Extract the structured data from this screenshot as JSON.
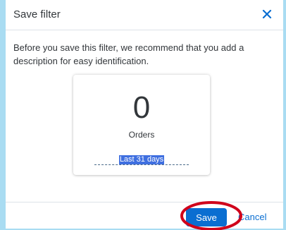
{
  "dialog": {
    "title": "Save filter",
    "close_icon": "close-icon",
    "message": "Before you save this filter, we recommend that you add a description for easy identification."
  },
  "kpi_card": {
    "value": "0",
    "label": "Orders",
    "period": "Last 31 days"
  },
  "footer": {
    "save_label": "Save",
    "cancel_label": "Cancel"
  },
  "colors": {
    "accent": "#0a6ed1",
    "highlight": "#3f6fe0",
    "annotation": "#d0021b",
    "background": "#a9dcf2"
  }
}
